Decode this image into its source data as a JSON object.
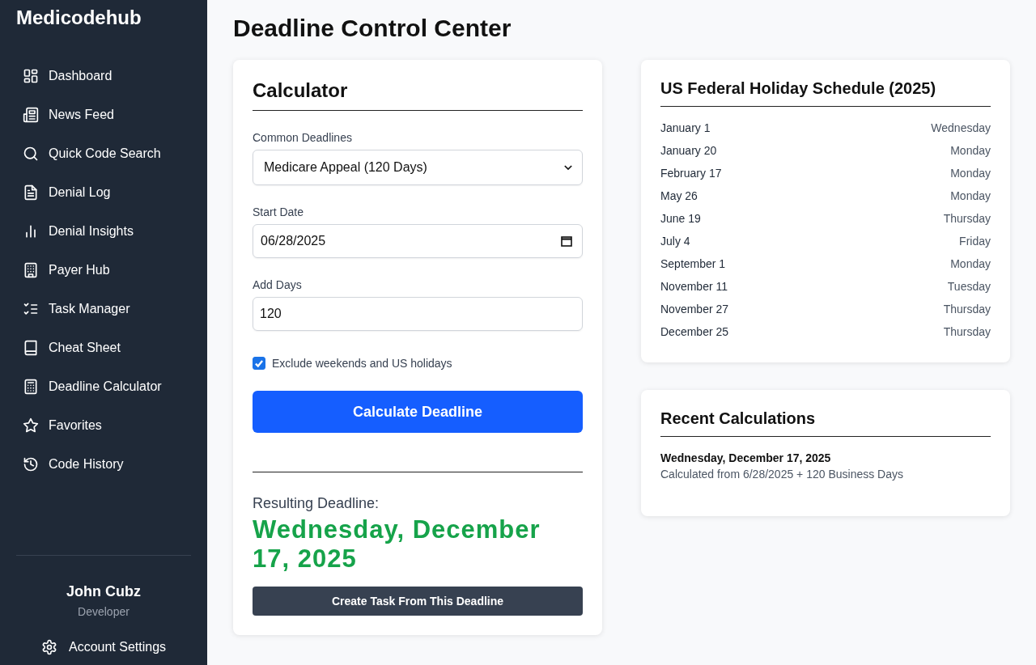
{
  "sidebar": {
    "brand": "Medicodehub",
    "items": [
      {
        "label": "Dashboard",
        "selected": false
      },
      {
        "label": "News Feed",
        "selected": false
      },
      {
        "label": "Quick Code Search",
        "selected": false
      },
      {
        "label": "Denial Log",
        "selected": false
      },
      {
        "label": "Denial Insights",
        "selected": false
      },
      {
        "label": "Payer Hub",
        "selected": false
      },
      {
        "label": "Task Manager",
        "selected": false
      },
      {
        "label": "Cheat Sheet",
        "selected": false
      },
      {
        "label": "Deadline Calculator",
        "selected": false
      },
      {
        "label": "Favorites",
        "selected": false
      },
      {
        "label": "Code History",
        "selected": false
      }
    ],
    "user": {
      "name": "John Cubz",
      "role": "Developer"
    },
    "settings": "Account Settings"
  },
  "page_title": "Deadline Control Center",
  "calculator": {
    "title": "Calculator",
    "deadline_label": "Common Deadlines",
    "deadline_value": "Medicare Appeal (120 Days)",
    "start_label": "Start Date",
    "start_value": "06/28/2025",
    "days_label": "Add Days",
    "days_value": "120",
    "exclude": {
      "label": "Exclude weekends and US holidays",
      "checked": true
    },
    "button": "Calculate Deadline",
    "result_label": "Resulting Deadline:",
    "result": "Wednesday, December 17, 2025",
    "task_button": "Create Task From This Deadline"
  },
  "holidays": {
    "title": "US Federal Holiday Schedule (2025)",
    "rows": [
      {
        "date": "January 1",
        "day": "Wednesday"
      },
      {
        "date": "January 20",
        "day": "Monday"
      },
      {
        "date": "February 17",
        "day": "Monday"
      },
      {
        "date": "May 26",
        "day": "Monday"
      },
      {
        "date": "June 19",
        "day": "Thursday"
      },
      {
        "date": "July 4",
        "day": "Friday"
      },
      {
        "date": "September 1",
        "day": "Monday"
      },
      {
        "date": "November 11",
        "day": "Tuesday"
      },
      {
        "date": "November 27",
        "day": "Thursday"
      },
      {
        "date": "December 25",
        "day": "Thursday"
      }
    ]
  },
  "recent": {
    "title": "Recent Calculations",
    "items": [
      {
        "date": "Wednesday, December 17, 2025",
        "detail": "Calculated from 6/28/2025 + 120 Business Days"
      }
    ]
  }
}
